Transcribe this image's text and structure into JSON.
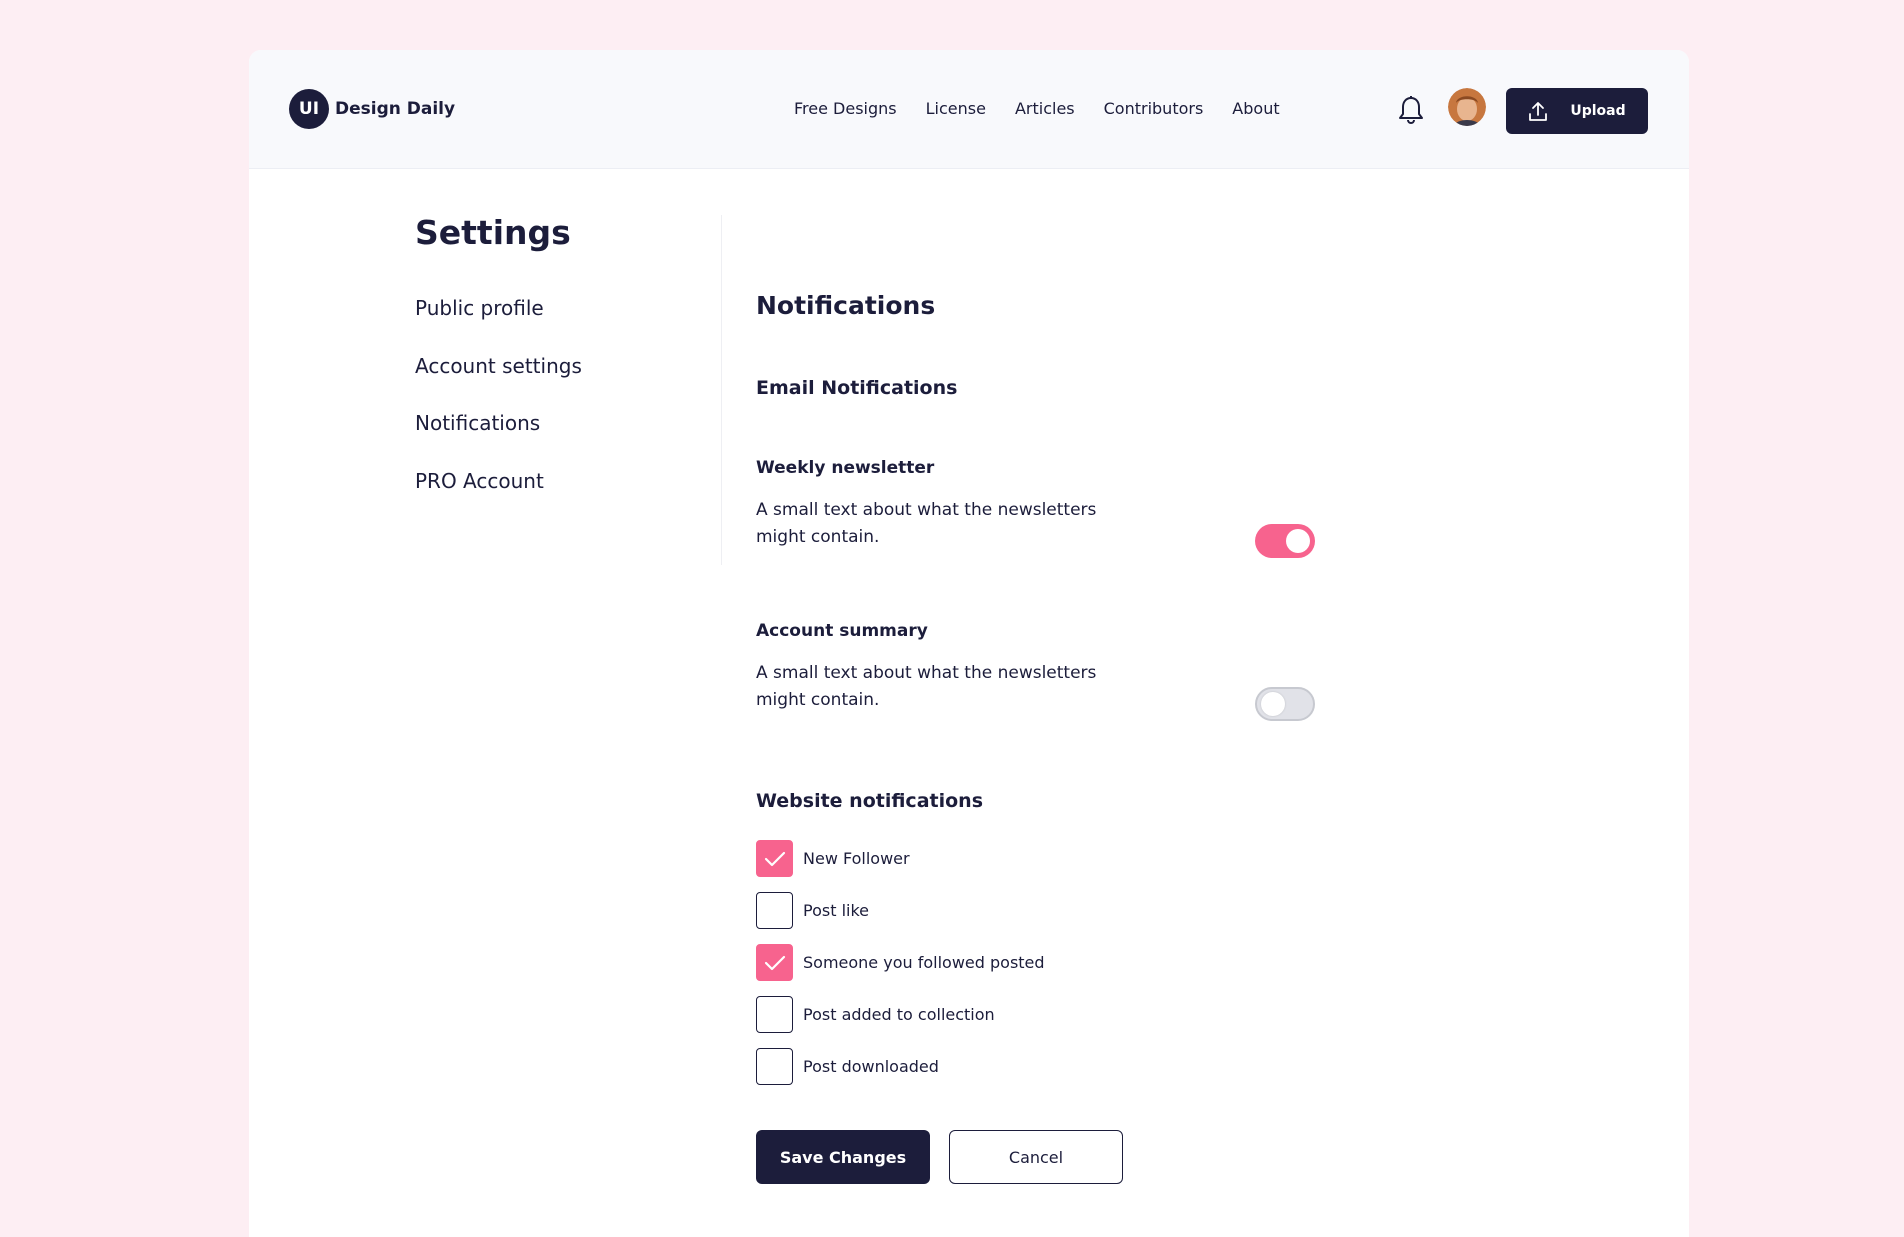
{
  "brand": {
    "mark": "UI",
    "name": "Design Daily"
  },
  "nav": {
    "items": [
      {
        "label": "Free Designs"
      },
      {
        "label": "License"
      },
      {
        "label": "Articles"
      },
      {
        "label": "Contributors"
      },
      {
        "label": "About"
      }
    ]
  },
  "header": {
    "bell_icon": "bell-icon",
    "upload_icon": "upload-icon",
    "upload_label": "Upload"
  },
  "sidebar": {
    "title": "Settings",
    "items": [
      {
        "label": "Public profile"
      },
      {
        "label": "Account settings"
      },
      {
        "label": "Notifications"
      },
      {
        "label": "PRO Account"
      }
    ]
  },
  "main": {
    "title": "Notifications",
    "email_section": {
      "title": "Email Notifications",
      "prefs": [
        {
          "title": "Weekly newsletter",
          "description": "A small text about what the newsletters might contain.",
          "enabled": true
        },
        {
          "title": "Account summary",
          "description": "A small text about what the newsletters might contain.",
          "enabled": false
        }
      ]
    },
    "website_section": {
      "title": "Website notifications",
      "options": [
        {
          "label": "New Follower",
          "checked": true
        },
        {
          "label": "Post like",
          "checked": false
        },
        {
          "label": "Someone you followed posted",
          "checked": true
        },
        {
          "label": "Post added to collection",
          "checked": false
        },
        {
          "label": "Post downloaded",
          "checked": false
        }
      ]
    },
    "actions": {
      "save_label": "Save Changes",
      "cancel_label": "Cancel"
    }
  },
  "colors": {
    "background": "#fdeef3",
    "primary": "#1c1d3b",
    "accent": "#f7638e",
    "toggle_off": "#e1e2e8"
  }
}
